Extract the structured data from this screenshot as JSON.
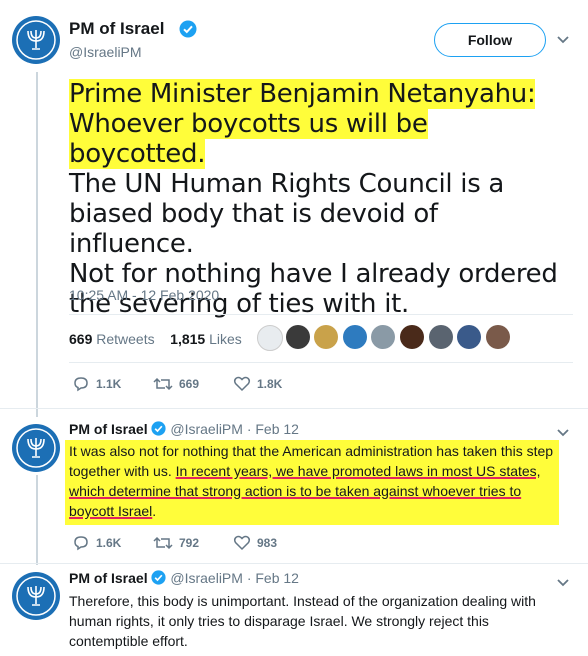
{
  "main_tweet": {
    "author": "PM of Israel",
    "handle": "@IsraeliPM",
    "follow_label": "Follow",
    "text_highlight_1": "Prime Minister Benjamin Netanyahu:",
    "text_highlight_2": "Whoever boycotts us will be boycotted.",
    "text_rest_1": "The UN Human Rights Council is a",
    "text_rest_2": "biased body that is devoid of influence.",
    "text_rest_3": "Not for nothing have I already ordered",
    "text_rest_4": "the severing of ties with it.",
    "timestamp": "10:25 AM - 12 Feb 2020",
    "retweets_count": "669",
    "retweets_label": "Retweets",
    "likes_count": "1,815",
    "likes_label": "Likes",
    "actions": {
      "replies": "1.1K",
      "retweets": "669",
      "likes": "1.8K"
    }
  },
  "replies": [
    {
      "author": "PM of Israel",
      "handle": "@IsraeliPM",
      "date": "· Feb 12",
      "text_plain": "It was also not for nothing that the American administration has taken this step together with us.",
      "text_underlined": "In recent years, we have promoted laws in most US states, which determine that strong action is to be taken against whoever tries to boycott Israel",
      "text_end": ".",
      "actions": {
        "replies": "1.6K",
        "retweets": "792",
        "likes": "983"
      }
    },
    {
      "author": "PM of Israel",
      "handle": "@IsraeliPM",
      "date": "· Feb 12",
      "text": "Therefore, this body is unimportant. Instead of the organization dealing with human rights, it only tries to disparage Israel. We strongly reject this contemptible effort."
    }
  ],
  "colors": {
    "accent": "#1da1f2",
    "highlight": "#fffd3a",
    "underline": "#e0245e",
    "avatar": "#1c6fb5"
  },
  "icons": [
    "menorah-icon",
    "verified-badge-icon",
    "chevron-down-icon",
    "reply-icon",
    "retweet-icon",
    "heart-icon"
  ]
}
